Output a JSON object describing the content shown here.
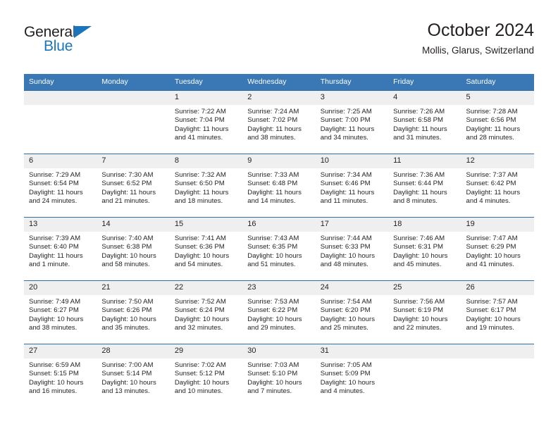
{
  "brand": {
    "name_part1": "General",
    "name_part2": "Blue",
    "accent_color": "#1b75bc",
    "triangle_icon": "triangle-icon"
  },
  "header": {
    "title": "October 2024",
    "subtitle": "Mollis, Glarus, Switzerland"
  },
  "colors": {
    "header_blue": "#3a77b5",
    "row_rule": "#2e6da4",
    "daynum_band": "#efefef",
    "text": "#231f20"
  },
  "weekday_headers": [
    "Sunday",
    "Monday",
    "Tuesday",
    "Wednesday",
    "Thursday",
    "Friday",
    "Saturday"
  ],
  "weeks": [
    [
      {
        "day": "",
        "sunrise": "",
        "sunset": "",
        "daylight_line1": "",
        "daylight_line2": ""
      },
      {
        "day": "",
        "sunrise": "",
        "sunset": "",
        "daylight_line1": "",
        "daylight_line2": ""
      },
      {
        "day": "1",
        "sunrise": "Sunrise: 7:22 AM",
        "sunset": "Sunset: 7:04 PM",
        "daylight_line1": "Daylight: 11 hours",
        "daylight_line2": "and 41 minutes."
      },
      {
        "day": "2",
        "sunrise": "Sunrise: 7:24 AM",
        "sunset": "Sunset: 7:02 PM",
        "daylight_line1": "Daylight: 11 hours",
        "daylight_line2": "and 38 minutes."
      },
      {
        "day": "3",
        "sunrise": "Sunrise: 7:25 AM",
        "sunset": "Sunset: 7:00 PM",
        "daylight_line1": "Daylight: 11 hours",
        "daylight_line2": "and 34 minutes."
      },
      {
        "day": "4",
        "sunrise": "Sunrise: 7:26 AM",
        "sunset": "Sunset: 6:58 PM",
        "daylight_line1": "Daylight: 11 hours",
        "daylight_line2": "and 31 minutes."
      },
      {
        "day": "5",
        "sunrise": "Sunrise: 7:28 AM",
        "sunset": "Sunset: 6:56 PM",
        "daylight_line1": "Daylight: 11 hours",
        "daylight_line2": "and 28 minutes."
      }
    ],
    [
      {
        "day": "6",
        "sunrise": "Sunrise: 7:29 AM",
        "sunset": "Sunset: 6:54 PM",
        "daylight_line1": "Daylight: 11 hours",
        "daylight_line2": "and 24 minutes."
      },
      {
        "day": "7",
        "sunrise": "Sunrise: 7:30 AM",
        "sunset": "Sunset: 6:52 PM",
        "daylight_line1": "Daylight: 11 hours",
        "daylight_line2": "and 21 minutes."
      },
      {
        "day": "8",
        "sunrise": "Sunrise: 7:32 AM",
        "sunset": "Sunset: 6:50 PM",
        "daylight_line1": "Daylight: 11 hours",
        "daylight_line2": "and 18 minutes."
      },
      {
        "day": "9",
        "sunrise": "Sunrise: 7:33 AM",
        "sunset": "Sunset: 6:48 PM",
        "daylight_line1": "Daylight: 11 hours",
        "daylight_line2": "and 14 minutes."
      },
      {
        "day": "10",
        "sunrise": "Sunrise: 7:34 AM",
        "sunset": "Sunset: 6:46 PM",
        "daylight_line1": "Daylight: 11 hours",
        "daylight_line2": "and 11 minutes."
      },
      {
        "day": "11",
        "sunrise": "Sunrise: 7:36 AM",
        "sunset": "Sunset: 6:44 PM",
        "daylight_line1": "Daylight: 11 hours",
        "daylight_line2": "and 8 minutes."
      },
      {
        "day": "12",
        "sunrise": "Sunrise: 7:37 AM",
        "sunset": "Sunset: 6:42 PM",
        "daylight_line1": "Daylight: 11 hours",
        "daylight_line2": "and 4 minutes."
      }
    ],
    [
      {
        "day": "13",
        "sunrise": "Sunrise: 7:39 AM",
        "sunset": "Sunset: 6:40 PM",
        "daylight_line1": "Daylight: 11 hours",
        "daylight_line2": "and 1 minute."
      },
      {
        "day": "14",
        "sunrise": "Sunrise: 7:40 AM",
        "sunset": "Sunset: 6:38 PM",
        "daylight_line1": "Daylight: 10 hours",
        "daylight_line2": "and 58 minutes."
      },
      {
        "day": "15",
        "sunrise": "Sunrise: 7:41 AM",
        "sunset": "Sunset: 6:36 PM",
        "daylight_line1": "Daylight: 10 hours",
        "daylight_line2": "and 54 minutes."
      },
      {
        "day": "16",
        "sunrise": "Sunrise: 7:43 AM",
        "sunset": "Sunset: 6:35 PM",
        "daylight_line1": "Daylight: 10 hours",
        "daylight_line2": "and 51 minutes."
      },
      {
        "day": "17",
        "sunrise": "Sunrise: 7:44 AM",
        "sunset": "Sunset: 6:33 PM",
        "daylight_line1": "Daylight: 10 hours",
        "daylight_line2": "and 48 minutes."
      },
      {
        "day": "18",
        "sunrise": "Sunrise: 7:46 AM",
        "sunset": "Sunset: 6:31 PM",
        "daylight_line1": "Daylight: 10 hours",
        "daylight_line2": "and 45 minutes."
      },
      {
        "day": "19",
        "sunrise": "Sunrise: 7:47 AM",
        "sunset": "Sunset: 6:29 PM",
        "daylight_line1": "Daylight: 10 hours",
        "daylight_line2": "and 41 minutes."
      }
    ],
    [
      {
        "day": "20",
        "sunrise": "Sunrise: 7:49 AM",
        "sunset": "Sunset: 6:27 PM",
        "daylight_line1": "Daylight: 10 hours",
        "daylight_line2": "and 38 minutes."
      },
      {
        "day": "21",
        "sunrise": "Sunrise: 7:50 AM",
        "sunset": "Sunset: 6:26 PM",
        "daylight_line1": "Daylight: 10 hours",
        "daylight_line2": "and 35 minutes."
      },
      {
        "day": "22",
        "sunrise": "Sunrise: 7:52 AM",
        "sunset": "Sunset: 6:24 PM",
        "daylight_line1": "Daylight: 10 hours",
        "daylight_line2": "and 32 minutes."
      },
      {
        "day": "23",
        "sunrise": "Sunrise: 7:53 AM",
        "sunset": "Sunset: 6:22 PM",
        "daylight_line1": "Daylight: 10 hours",
        "daylight_line2": "and 29 minutes."
      },
      {
        "day": "24",
        "sunrise": "Sunrise: 7:54 AM",
        "sunset": "Sunset: 6:20 PM",
        "daylight_line1": "Daylight: 10 hours",
        "daylight_line2": "and 25 minutes."
      },
      {
        "day": "25",
        "sunrise": "Sunrise: 7:56 AM",
        "sunset": "Sunset: 6:19 PM",
        "daylight_line1": "Daylight: 10 hours",
        "daylight_line2": "and 22 minutes."
      },
      {
        "day": "26",
        "sunrise": "Sunrise: 7:57 AM",
        "sunset": "Sunset: 6:17 PM",
        "daylight_line1": "Daylight: 10 hours",
        "daylight_line2": "and 19 minutes."
      }
    ],
    [
      {
        "day": "27",
        "sunrise": "Sunrise: 6:59 AM",
        "sunset": "Sunset: 5:15 PM",
        "daylight_line1": "Daylight: 10 hours",
        "daylight_line2": "and 16 minutes."
      },
      {
        "day": "28",
        "sunrise": "Sunrise: 7:00 AM",
        "sunset": "Sunset: 5:14 PM",
        "daylight_line1": "Daylight: 10 hours",
        "daylight_line2": "and 13 minutes."
      },
      {
        "day": "29",
        "sunrise": "Sunrise: 7:02 AM",
        "sunset": "Sunset: 5:12 PM",
        "daylight_line1": "Daylight: 10 hours",
        "daylight_line2": "and 10 minutes."
      },
      {
        "day": "30",
        "sunrise": "Sunrise: 7:03 AM",
        "sunset": "Sunset: 5:10 PM",
        "daylight_line1": "Daylight: 10 hours",
        "daylight_line2": "and 7 minutes."
      },
      {
        "day": "31",
        "sunrise": "Sunrise: 7:05 AM",
        "sunset": "Sunset: 5:09 PM",
        "daylight_line1": "Daylight: 10 hours",
        "daylight_line2": "and 4 minutes."
      },
      {
        "day": "",
        "sunrise": "",
        "sunset": "",
        "daylight_line1": "",
        "daylight_line2": ""
      },
      {
        "day": "",
        "sunrise": "",
        "sunset": "",
        "daylight_line1": "",
        "daylight_line2": ""
      }
    ]
  ]
}
